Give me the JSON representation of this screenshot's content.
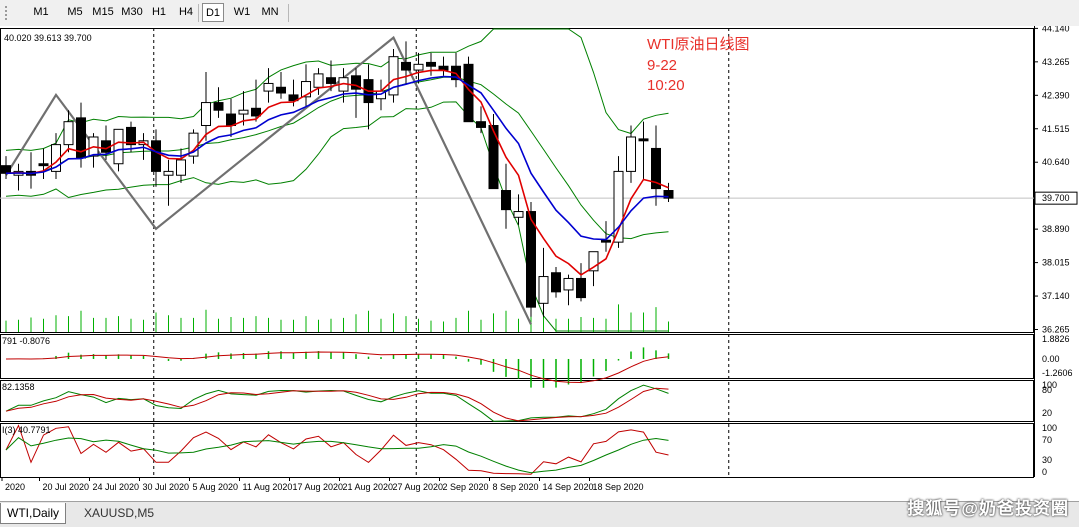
{
  "toolbar": {
    "timeframes": [
      "M1",
      "M5",
      "M15",
      "M30",
      "H1",
      "H4",
      "D1",
      "W1",
      "MN"
    ],
    "active": "D1"
  },
  "ohlc_readout": "40.020 39.613 39.700",
  "annotation": {
    "title": "WTI原油日线图",
    "date": "9-22",
    "time": "10:20",
    "color": "#e8302a"
  },
  "watermark": "搜狐号@奶爸投资圈",
  "tabs": [
    {
      "label": "WTI,Daily",
      "active": true
    },
    {
      "label": "XAUUSD,M5",
      "active": false
    }
  ],
  "colors": {
    "bull": "#ffffff",
    "bear": "#000000",
    "fast_ma": "#e00000",
    "slow_ma": "#0000d0",
    "bands": "#008000",
    "zigzag": "#707070",
    "volume": "#00b000"
  },
  "chart_data": {
    "type": "candlestick",
    "price_axis": {
      "range": [
        36.2,
        44.15
      ],
      "ticks": [
        "44.140",
        "43.265",
        "42.390",
        "41.515",
        "40.640",
        "39.700",
        "38.890",
        "38.015",
        "37.140",
        "36.265"
      ],
      "current_price": 39.7
    },
    "x_labels": [
      {
        "index": 0,
        "label": "2020"
      },
      {
        "index": 3,
        "label": "20 Jul 2020"
      },
      {
        "index": 7,
        "label": "24 Jul 2020"
      },
      {
        "index": 11,
        "label": "30 Jul 2020"
      },
      {
        "index": 15,
        "label": "5 Aug 2020"
      },
      {
        "index": 19,
        "label": "11 Aug 2020"
      },
      {
        "index": 23,
        "label": "17 Aug 2020"
      },
      {
        "index": 27,
        "label": "21 Aug 2020"
      },
      {
        "index": 31,
        "label": "27 Aug 2020"
      },
      {
        "index": 35,
        "label": "2 Sep 2020"
      },
      {
        "index": 39,
        "label": "8 Sep 2020"
      },
      {
        "index": 43,
        "label": "14 Sep 2020"
      },
      {
        "index": 47,
        "label": "18 Sep 2020"
      }
    ],
    "period_separators": [
      12,
      33,
      58
    ],
    "candles": [
      {
        "o": 40.55,
        "h": 40.8,
        "l": 40.2,
        "c": 40.35
      },
      {
        "o": 40.3,
        "h": 40.6,
        "l": 39.9,
        "c": 40.4
      },
      {
        "o": 40.4,
        "h": 40.9,
        "l": 39.95,
        "c": 40.3
      },
      {
        "o": 40.6,
        "h": 41.0,
        "l": 40.2,
        "c": 40.55
      },
      {
        "o": 40.4,
        "h": 41.4,
        "l": 40.2,
        "c": 41.1
      },
      {
        "o": 41.1,
        "h": 42.0,
        "l": 40.9,
        "c": 41.7
      },
      {
        "o": 41.8,
        "h": 42.2,
        "l": 40.5,
        "c": 40.75
      },
      {
        "o": 40.8,
        "h": 41.4,
        "l": 40.5,
        "c": 41.3
      },
      {
        "o": 41.2,
        "h": 41.6,
        "l": 40.7,
        "c": 40.9
      },
      {
        "o": 40.6,
        "h": 41.5,
        "l": 40.4,
        "c": 41.5
      },
      {
        "o": 41.55,
        "h": 41.7,
        "l": 40.9,
        "c": 41.1
      },
      {
        "o": 41.1,
        "h": 41.4,
        "l": 40.7,
        "c": 41.2
      },
      {
        "o": 41.2,
        "h": 41.5,
        "l": 40.0,
        "c": 40.4
      },
      {
        "o": 40.3,
        "h": 40.7,
        "l": 39.5,
        "c": 40.4
      },
      {
        "o": 40.3,
        "h": 41.0,
        "l": 40.1,
        "c": 40.7
      },
      {
        "o": 40.8,
        "h": 41.5,
        "l": 40.6,
        "c": 41.4
      },
      {
        "o": 41.6,
        "h": 43.0,
        "l": 41.2,
        "c": 42.2
      },
      {
        "o": 42.2,
        "h": 42.6,
        "l": 41.8,
        "c": 42.0
      },
      {
        "o": 41.9,
        "h": 42.3,
        "l": 41.3,
        "c": 41.6
      },
      {
        "o": 41.9,
        "h": 42.5,
        "l": 41.6,
        "c": 42.0
      },
      {
        "o": 42.05,
        "h": 42.8,
        "l": 41.7,
        "c": 41.85
      },
      {
        "o": 42.5,
        "h": 43.1,
        "l": 42.2,
        "c": 42.7
      },
      {
        "o": 42.6,
        "h": 43.0,
        "l": 42.3,
        "c": 42.45
      },
      {
        "o": 42.4,
        "h": 42.8,
        "l": 42.1,
        "c": 42.25
      },
      {
        "o": 42.35,
        "h": 43.2,
        "l": 42.1,
        "c": 42.75
      },
      {
        "o": 42.6,
        "h": 43.1,
        "l": 42.4,
        "c": 42.95
      },
      {
        "o": 42.85,
        "h": 43.3,
        "l": 42.5,
        "c": 42.7
      },
      {
        "o": 42.5,
        "h": 43.1,
        "l": 42.2,
        "c": 42.85
      },
      {
        "o": 42.9,
        "h": 43.1,
        "l": 41.8,
        "c": 42.55
      },
      {
        "o": 42.8,
        "h": 43.2,
        "l": 41.5,
        "c": 42.2
      },
      {
        "o": 42.3,
        "h": 42.8,
        "l": 42.0,
        "c": 42.5
      },
      {
        "o": 42.4,
        "h": 43.6,
        "l": 42.2,
        "c": 43.4
      },
      {
        "o": 43.25,
        "h": 43.8,
        "l": 42.7,
        "c": 43.05
      },
      {
        "o": 43.05,
        "h": 43.5,
        "l": 42.7,
        "c": 43.2
      },
      {
        "o": 43.25,
        "h": 43.5,
        "l": 42.9,
        "c": 43.15
      },
      {
        "o": 43.15,
        "h": 43.4,
        "l": 42.9,
        "c": 43.05
      },
      {
        "o": 43.15,
        "h": 43.5,
        "l": 42.6,
        "c": 42.8
      },
      {
        "o": 43.2,
        "h": 43.4,
        "l": 41.7,
        "c": 41.7
      },
      {
        "o": 41.7,
        "h": 42.1,
        "l": 41.4,
        "c": 41.55
      },
      {
        "o": 41.6,
        "h": 41.9,
        "l": 40.5,
        "c": 39.95
      },
      {
        "o": 39.9,
        "h": 40.6,
        "l": 38.9,
        "c": 39.4
      },
      {
        "o": 39.2,
        "h": 39.8,
        "l": 39.0,
        "c": 39.35
      },
      {
        "o": 39.35,
        "h": 39.6,
        "l": 36.6,
        "c": 36.85
      },
      {
        "o": 36.95,
        "h": 38.4,
        "l": 36.6,
        "c": 37.65
      },
      {
        "o": 37.75,
        "h": 37.9,
        "l": 37.1,
        "c": 37.25
      },
      {
        "o": 37.3,
        "h": 37.7,
        "l": 36.9,
        "c": 37.6
      },
      {
        "o": 37.6,
        "h": 38.0,
        "l": 37.0,
        "c": 37.1
      },
      {
        "o": 37.8,
        "h": 38.3,
        "l": 37.4,
        "c": 38.3
      },
      {
        "o": 38.6,
        "h": 39.1,
        "l": 38.3,
        "c": 38.55
      },
      {
        "o": 38.55,
        "h": 40.8,
        "l": 38.4,
        "c": 40.4
      },
      {
        "o": 40.4,
        "h": 41.6,
        "l": 40.1,
        "c": 41.3
      },
      {
        "o": 41.25,
        "h": 41.7,
        "l": 40.2,
        "c": 41.2
      },
      {
        "o": 41.0,
        "h": 41.6,
        "l": 39.5,
        "c": 39.95
      },
      {
        "o": 39.9,
        "h": 40.1,
        "l": 39.6,
        "c": 39.7
      }
    ],
    "volume_note": "histogram at bottom of main pane, no values printed",
    "indicators": [
      {
        "name": "MACD",
        "readout": "791 -0.8076",
        "ticks": [
          "1.8826",
          "0.00",
          "-1.2606"
        ],
        "range": [
          -1.6,
          2.1
        ]
      },
      {
        "name": "Stochastic",
        "readout": "82.1358",
        "ticks": [
          "100",
          "80",
          "20"
        ],
        "range": [
          0,
          105
        ]
      },
      {
        "name": "RSI",
        "readout": "I(3) 40.7791",
        "ticks": [
          "100",
          "70",
          "30",
          "0"
        ],
        "range": [
          -5,
          105
        ]
      }
    ]
  }
}
